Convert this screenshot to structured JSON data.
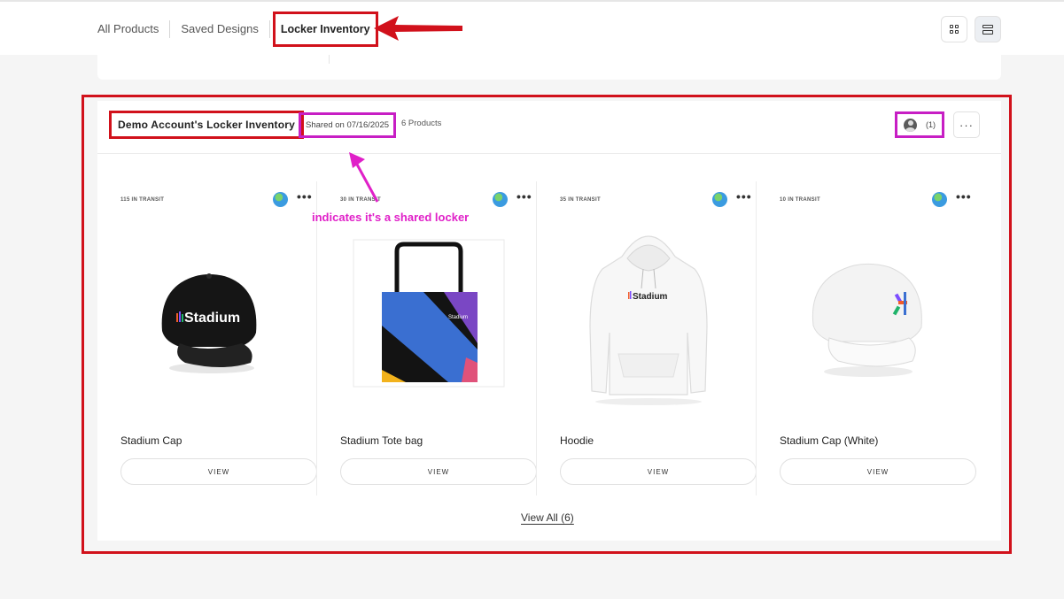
{
  "tabs": [
    {
      "label": "All Products"
    },
    {
      "label": "Saved Designs"
    },
    {
      "label": "Locker Inventory",
      "active": true
    }
  ],
  "view_toggle": {
    "grid_icon": "grid-icon",
    "list_icon": "list-icon",
    "active": "list"
  },
  "locker": {
    "title": "Demo Account's Locker Inventory",
    "shared": "Shared on 07/16/2025",
    "product_count": "6 Products",
    "members_count": "(1)",
    "more": "···",
    "view_all": "View All (6)"
  },
  "products": [
    {
      "transit": "115 IN TRANSIT",
      "name": "Stadium Cap",
      "view_label": "VIEW",
      "image": "black-cap"
    },
    {
      "transit": "30 IN TRANSIT",
      "name": "Stadium Tote bag",
      "view_label": "VIEW",
      "image": "tote-bag"
    },
    {
      "transit": "35 IN TRANSIT",
      "name": "Hoodie",
      "view_label": "VIEW",
      "image": "white-hoodie"
    },
    {
      "transit": "10 IN TRANSIT",
      "name": "Stadium Cap (White)",
      "view_label": "VIEW",
      "image": "white-cap"
    }
  ],
  "product_dots": "•••",
  "logo_text": "Stadium",
  "annotation": {
    "text": "indicates it's a shared locker",
    "color": "#e020c8"
  },
  "colors": {
    "highlight_red": "#d1111b",
    "highlight_magenta": "#c71ec4"
  }
}
